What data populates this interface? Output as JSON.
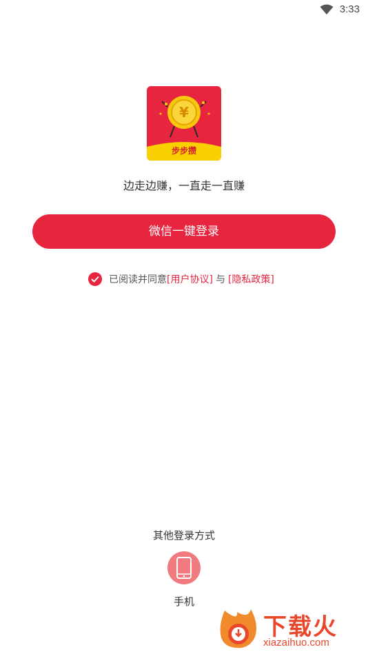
{
  "status": {
    "time": "3:33",
    "wifi_icon": "wifi-icon"
  },
  "app": {
    "logo_label": "步步攒",
    "coin_symbol": "¥",
    "slogan": "边走边赚，一直走一直赚"
  },
  "login": {
    "wechat_button": "微信一键登录"
  },
  "agreement": {
    "prefix": "已阅读并同意",
    "user_agreement": "[用户协议]",
    "and": "与",
    "privacy_policy": "[隐私政策]",
    "checked": true
  },
  "other_login": {
    "title": "其他登录方式",
    "phone_label": "手机",
    "phone_icon": "phone-icon"
  },
  "watermark": {
    "title": "下载火",
    "domain": "xiazaihuo.com"
  },
  "colors": {
    "accent": "#e8253f",
    "phone_bg": "#ef7a80",
    "logo_gold": "#f9c80e"
  }
}
